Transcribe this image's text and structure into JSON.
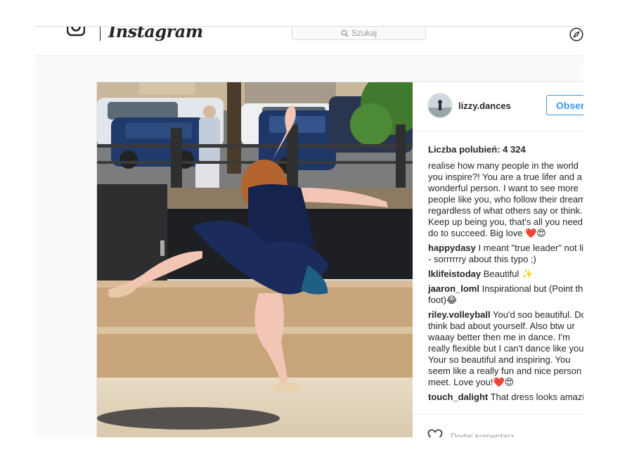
{
  "nav": {
    "wordmark": "Instagram",
    "search_placeholder": "Szukaj"
  },
  "post": {
    "username": "lizzy.dances",
    "follow_label": "Obserwuj",
    "likes_label": "Liczba polubień: 4 324",
    "caption_lines": [
      "realise how many people in the world",
      "you inspire?! You are a true lifer and a",
      "wonderful person. I want to see more",
      "people like you, who follow their dreams",
      "regardless of what others say or think.",
      "Keep up being you, that's all you need",
      "do to succeed. Big love ❤️😍"
    ],
    "comments": [
      {
        "user": "happydasy",
        "lines": [
          "I meant \"true leader\" not lifer",
          "- sorrrrrry about this typo ;)"
        ]
      },
      {
        "user": "lklifeistoday",
        "lines": [
          "Beautiful ✨"
        ]
      },
      {
        "user": "jaaron_loml",
        "lines": [
          "Inspirational but (Point that",
          "foot)😂"
        ]
      },
      {
        "user": "riley.volleyball",
        "lines": [
          "You'd soo beautiful. Don't",
          "think bad about yourself. Also btw ur",
          "waaay better then me in dance. I'm",
          "really flexible but I can't dance like you.",
          "Your so beautiful and inspiring. You",
          "seem like a really fun and nice person to",
          "meet. Love you!❤️😍"
        ]
      },
      {
        "user": "touch_dalight",
        "lines": [
          "That dress looks amazing"
        ]
      }
    ],
    "add_comment_placeholder": "Dodaj komentarz..."
  },
  "colors": {
    "accent": "#3897f0",
    "text": "#262626",
    "border": "#dbdbdb"
  },
  "icons": [
    "instagram-camera-icon",
    "search-icon",
    "compass-icon",
    "heart-icon"
  ]
}
